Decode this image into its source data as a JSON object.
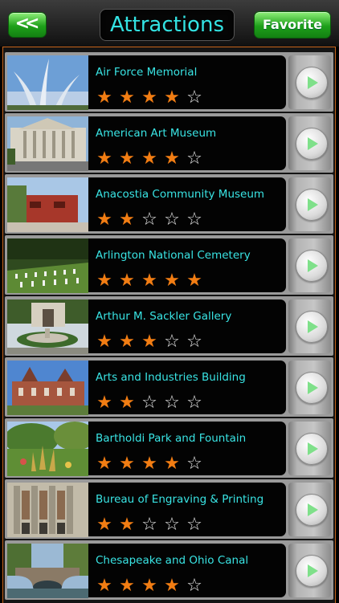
{
  "header": {
    "back_label": "<<",
    "title": "Attractions",
    "favorite_label": "Favorite"
  },
  "colors": {
    "accent_text": "#33e3e3",
    "star_on": "#f27d13",
    "button_green": "#1ea01a",
    "frame_orange": "#c8641a"
  },
  "attractions": [
    {
      "name": "Air Force Memorial",
      "rating": 4,
      "max": 5
    },
    {
      "name": "American Art Museum",
      "rating": 4,
      "max": 5
    },
    {
      "name": "Anacostia Community Museum",
      "rating": 2,
      "max": 5
    },
    {
      "name": "Arlington National Cemetery",
      "rating": 5,
      "max": 5
    },
    {
      "name": "Arthur M. Sackler Gallery",
      "rating": 3,
      "max": 5
    },
    {
      "name": "Arts and Industries Building",
      "rating": 2,
      "max": 5
    },
    {
      "name": "Bartholdi Park and Fountain",
      "rating": 4,
      "max": 5
    },
    {
      "name": "Bureau of Engraving & Printing",
      "rating": 2,
      "max": 5
    },
    {
      "name": "Chesapeake and Ohio Canal",
      "rating": 4,
      "max": 5
    }
  ]
}
